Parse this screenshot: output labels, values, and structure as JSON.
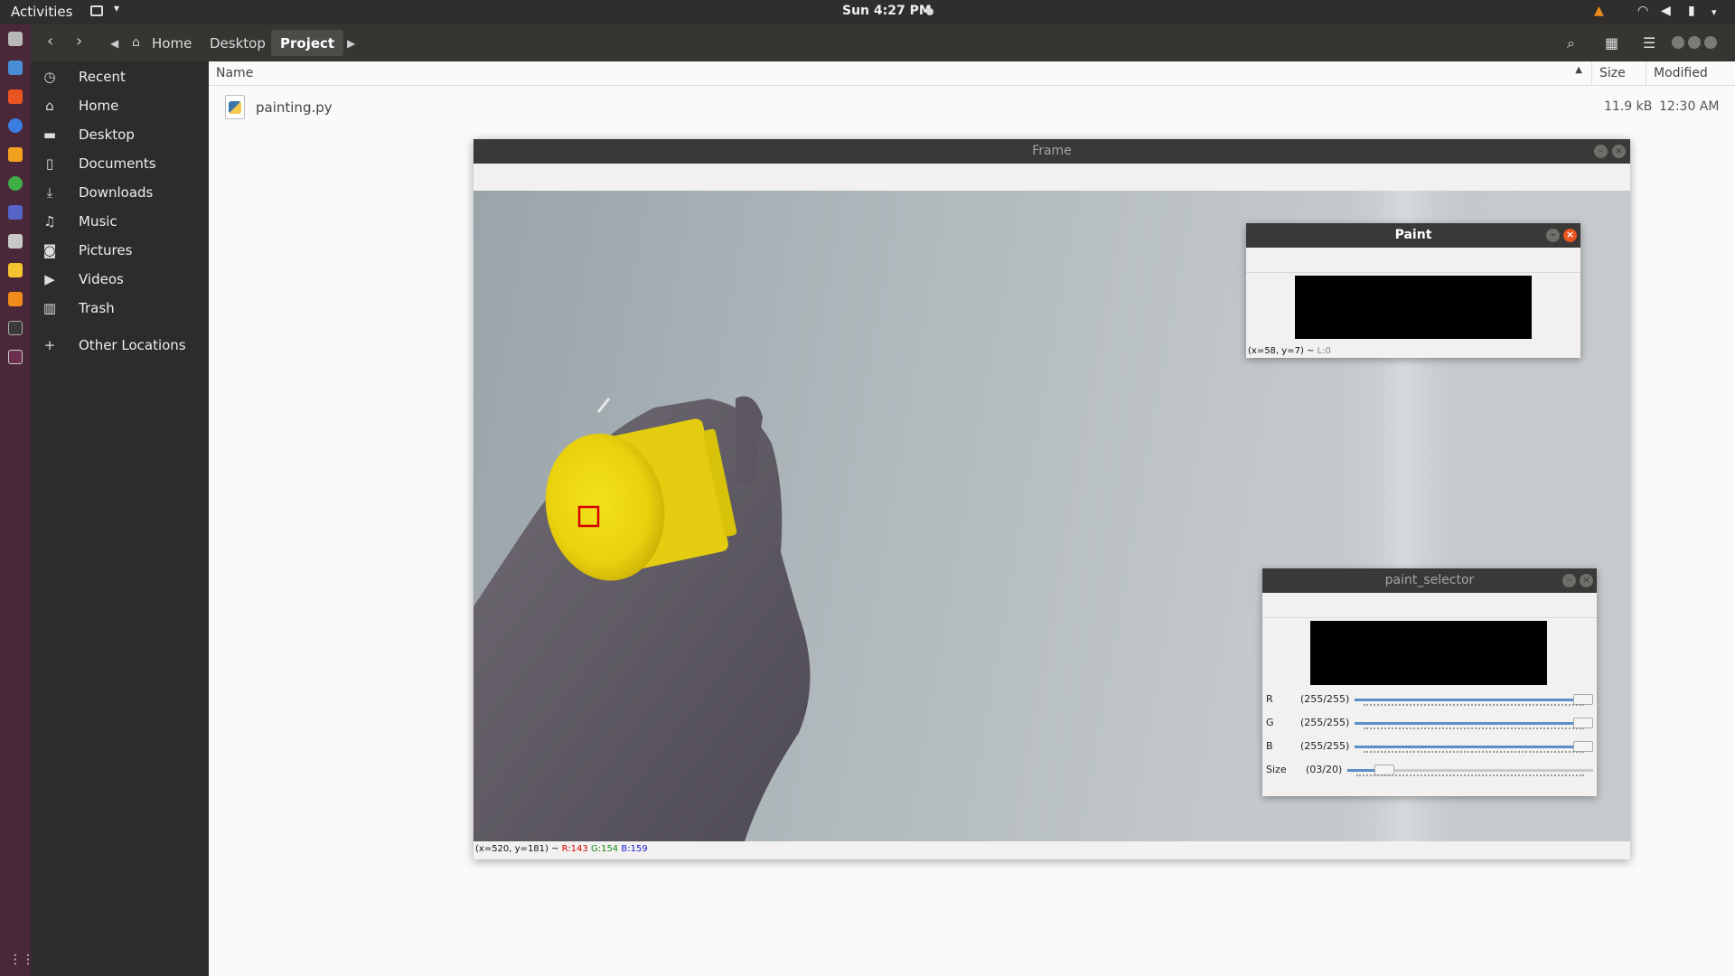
{
  "topbar": {
    "activities": "Activities",
    "clock": "Sun  4:27 PM"
  },
  "nav": {
    "crumbs": [
      "Home",
      "Desktop",
      "Project"
    ]
  },
  "sidebar": {
    "items": [
      {
        "label": "Recent",
        "icon": "clock-icon"
      },
      {
        "label": "Home",
        "icon": "home-icon"
      },
      {
        "label": "Desktop",
        "icon": "folder-icon"
      },
      {
        "label": "Documents",
        "icon": "document-icon"
      },
      {
        "label": "Downloads",
        "icon": "download-icon"
      },
      {
        "label": "Music",
        "icon": "music-icon"
      },
      {
        "label": "Pictures",
        "icon": "camera-icon"
      },
      {
        "label": "Videos",
        "icon": "video-icon"
      },
      {
        "label": "Trash",
        "icon": "trash-icon"
      },
      {
        "label": "Other Locations",
        "icon": "plus-icon"
      }
    ]
  },
  "filelist": {
    "columns": {
      "name": "Name",
      "size": "Size",
      "modified": "Modified"
    },
    "rows": [
      {
        "name": "painting.py",
        "size": "11.9 kB",
        "modified": "12:30 AM"
      }
    ]
  },
  "frame": {
    "title": "Frame",
    "status": {
      "coords": "(x=520, y=181) ~ ",
      "r": "R:143",
      "g": "G:154",
      "b": "B:159"
    }
  },
  "paint": {
    "title": "Paint",
    "status": {
      "coords": "(x=58, y=7) ~ ",
      "l": "L:0"
    }
  },
  "selector": {
    "title": "paint_selector",
    "trackbars": [
      {
        "name": "R",
        "value_text": "(255/255)",
        "value": 255,
        "max": 255
      },
      {
        "name": "G",
        "value_text": "(255/255)",
        "value": 255,
        "max": 255
      },
      {
        "name": "B",
        "value_text": "(255/255)",
        "value": 255,
        "max": 255
      },
      {
        "name": "Size",
        "value_text": "(03/20)",
        "value": 3,
        "max": 20
      }
    ]
  },
  "colors": {
    "accent_orange": "#e95420",
    "marker_box": "#d40000",
    "status_r": "#d40000",
    "status_g": "#1a8c1a",
    "status_b": "#1a1acc"
  }
}
